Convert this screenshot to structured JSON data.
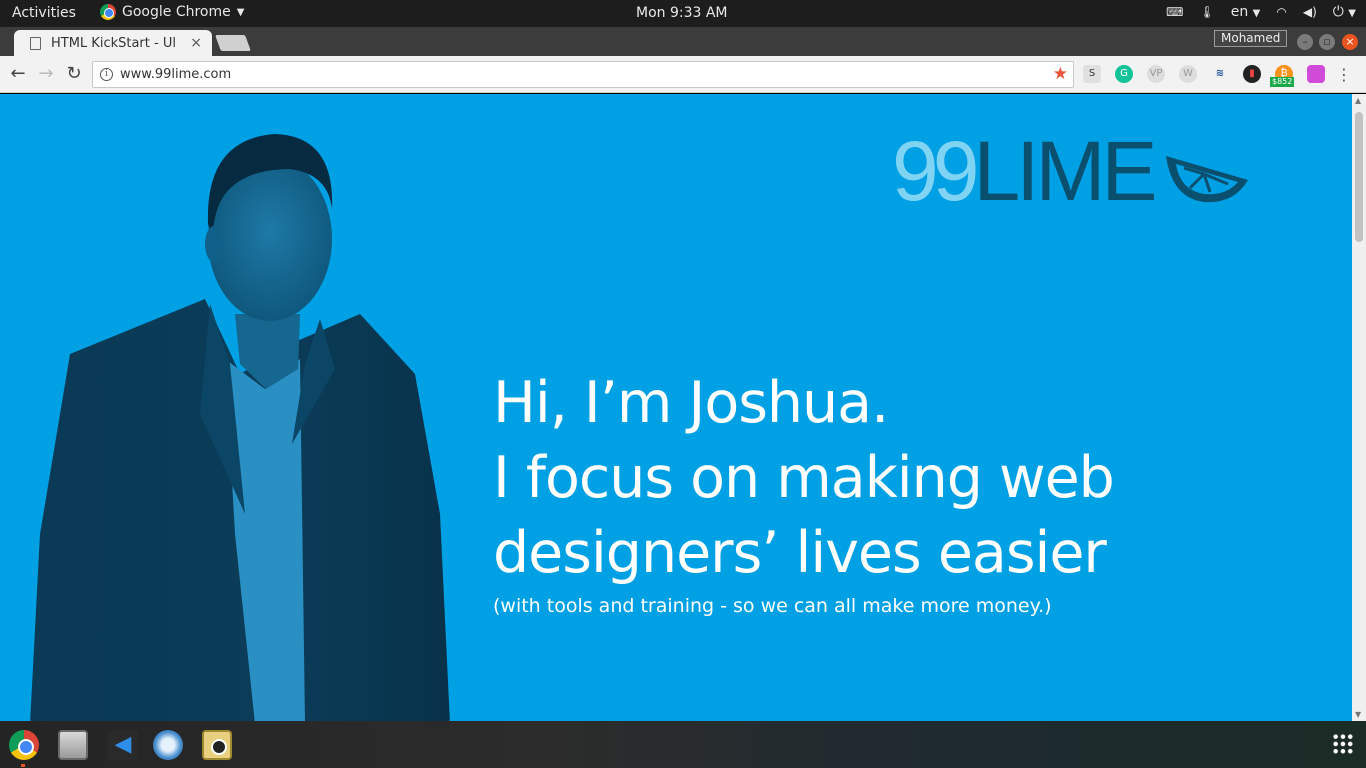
{
  "topbar": {
    "activities": "Activities",
    "app_name": "Google Chrome",
    "clock": "Mon  9:33 AM",
    "language": "en"
  },
  "browser": {
    "tab_title": "HTML KickStart - Ul",
    "tab_close": "×",
    "profile_name": "Mohamed",
    "url": "www.99lime.com",
    "extension_badge": "$852"
  },
  "page": {
    "logo": {
      "part1": "99",
      "part2": "LIME"
    },
    "hero_lines": [
      "Hi, I’m Joshua.",
      "I focus on making web",
      "designers’ lives easier"
    ],
    "subtitle": "(with tools and training - so we can all make more money.)",
    "background_color": "#00a0e4"
  },
  "dock": {
    "apps": [
      "chrome-icon",
      "files-icon",
      "vscode-icon",
      "safari-icon",
      "rhythmbox-icon"
    ]
  }
}
